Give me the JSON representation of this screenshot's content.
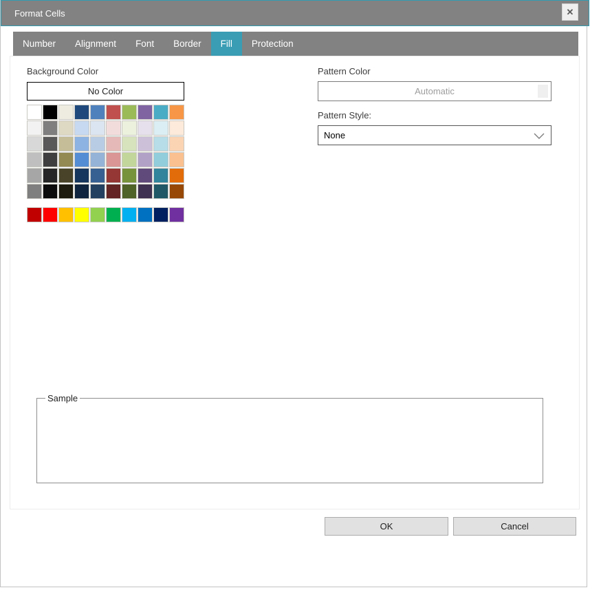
{
  "window": {
    "title": "Format Cells",
    "close_glyph": "✕"
  },
  "icons": {
    "close": "close-icon",
    "chevron_down": "chevron-down-icon"
  },
  "colors": {
    "accent_teal": "#3A9DB4",
    "titlebar_gray": "#828282",
    "button_face": "#E1E1E1"
  },
  "tabs": [
    {
      "label": "Number",
      "active": false
    },
    {
      "label": "Alignment",
      "active": false
    },
    {
      "label": "Font",
      "active": false
    },
    {
      "label": "Border",
      "active": false
    },
    {
      "label": "Fill",
      "active": true
    },
    {
      "label": "Protection",
      "active": false
    }
  ],
  "fill_tab": {
    "background_color_label": "Background Color",
    "no_color_button": "No Color",
    "pattern_color_label": "Pattern Color",
    "automatic_button": "Automatic",
    "pattern_style_label": "Pattern Style:",
    "pattern_style_value": "None",
    "sample_label": "Sample",
    "palette": {
      "theme_rows": [
        [
          "#FFFFFF",
          "#000000",
          "#EEECE1",
          "#1F497D",
          "#4F81BD",
          "#C0504D",
          "#9BBB59",
          "#8064A2",
          "#4BACC6",
          "#F79646"
        ],
        [
          "#F2F2F2",
          "#7F7F7F",
          "#DDD9C3",
          "#C6D9F0",
          "#DBE5F1",
          "#F2DCDB",
          "#EBF1DD",
          "#E6E0EC",
          "#DBEEF3",
          "#FDEADA"
        ],
        [
          "#D8D8D8",
          "#595959",
          "#C4BD97",
          "#8DB3E2",
          "#B8CCE4",
          "#E5B9B7",
          "#D6E3BC",
          "#CCC0D9",
          "#B6DDE8",
          "#FBD4B4"
        ],
        [
          "#BFBFBF",
          "#3F3F3F",
          "#938953",
          "#548DD4",
          "#95B3D7",
          "#D99694",
          "#C2D69B",
          "#B2A1C7",
          "#92CDDC",
          "#FAC08F"
        ],
        [
          "#A6A6A6",
          "#262626",
          "#494429",
          "#17365D",
          "#366092",
          "#953735",
          "#77933C",
          "#604A7B",
          "#31849B",
          "#E36C0A"
        ],
        [
          "#7F7F7F",
          "#0C0C0C",
          "#1D1B10",
          "#0F243E",
          "#244061",
          "#632423",
          "#4F6228",
          "#3F3151",
          "#205867",
          "#974806"
        ]
      ],
      "standard_row": [
        "#C00000",
        "#FF0000",
        "#FFC000",
        "#FFFF00",
        "#92D050",
        "#00B050",
        "#00B0F0",
        "#0070C0",
        "#002060",
        "#7030A0"
      ]
    }
  },
  "buttons": {
    "ok": "OK",
    "cancel": "Cancel"
  }
}
